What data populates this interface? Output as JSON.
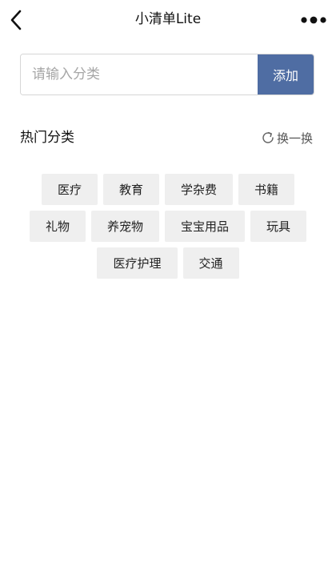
{
  "navbar": {
    "title": "小清单Lite",
    "back_icon": "chevron-left-icon",
    "more_icon": "more-dots-icon"
  },
  "add_form": {
    "placeholder": "请输入分类",
    "value": "",
    "button_label": "添加",
    "button_color": "#4f6da3"
  },
  "hot": {
    "title": "热门分类",
    "refresh_label": "换一换",
    "refresh_icon": "refresh-icon",
    "rows": [
      [
        "医疗",
        "教育",
        "学杂费",
        "书籍"
      ],
      [
        "礼物",
        "养宠物",
        "宝宝用品",
        "玩具"
      ],
      [
        "医疗护理",
        "交通"
      ]
    ]
  }
}
